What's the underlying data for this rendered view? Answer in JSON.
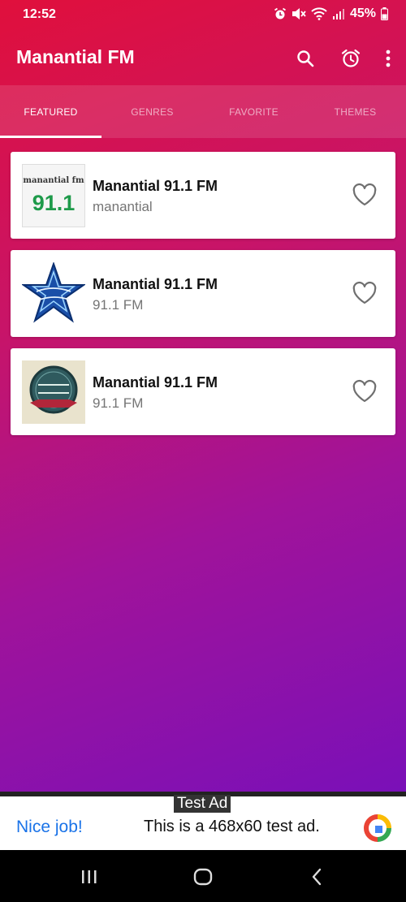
{
  "status_bar": {
    "time": "12:52",
    "battery": "45%"
  },
  "app_bar": {
    "title": "Manantial FM"
  },
  "tabs": [
    {
      "label": "FEATURED",
      "active": true
    },
    {
      "label": "GENRES",
      "active": false
    },
    {
      "label": "FAVORITE",
      "active": false
    },
    {
      "label": "THEMES",
      "active": false
    }
  ],
  "stations": [
    {
      "name": "Manantial 91.1 FM",
      "subtitle": "manantial",
      "logo": {
        "line1": "manantial fm",
        "line2": "91.1"
      }
    },
    {
      "name": "Manantial 91.1 FM",
      "subtitle": "91.1 FM"
    },
    {
      "name": "Manantial 91.1 FM",
      "subtitle": "91.1 FM"
    }
  ],
  "ad": {
    "label": "Test Ad",
    "left_text": "Nice job!",
    "right_text": "This is a 468x60 test ad."
  },
  "colors": {
    "gradient_start": "#e0103c",
    "gradient_end": "#7a10b8",
    "accent_green": "#1e9a4a",
    "ad_link": "#1a73e8"
  }
}
